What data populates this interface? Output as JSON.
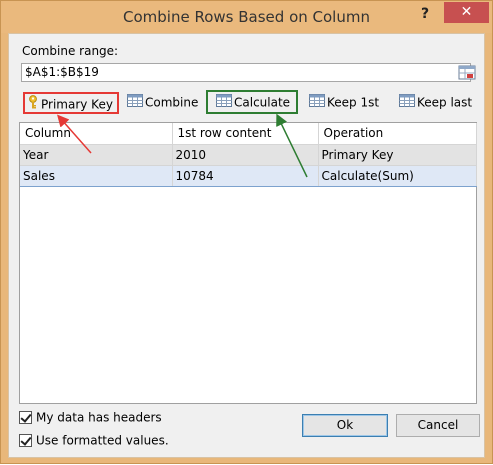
{
  "window": {
    "title": "Combine Rows Based on Column",
    "help_label": "?",
    "close_label": "✕"
  },
  "range": {
    "label": "Combine range:",
    "value": "$A$1:$B$19"
  },
  "toolbar": {
    "primary_key": "Primary Key",
    "combine": "Combine",
    "calculate": "Calculate",
    "keep_first": "Keep 1st",
    "keep_last": "Keep last"
  },
  "grid": {
    "columns": [
      "Column",
      "1st row content",
      "Operation"
    ],
    "rows": [
      {
        "column": "Year",
        "content": "2010",
        "operation": "Primary Key"
      },
      {
        "column": "Sales",
        "content": "10784",
        "operation": "Calculate(Sum)"
      }
    ]
  },
  "options": {
    "headers_label": "My data has headers",
    "formatted_label": "Use formatted values."
  },
  "buttons": {
    "ok": "Ok",
    "cancel": "Cancel"
  },
  "colors": {
    "title_bar": "#eab97d",
    "highlight_red": "#e53935",
    "highlight_green": "#2e7d32",
    "close_button": "#c75050"
  }
}
